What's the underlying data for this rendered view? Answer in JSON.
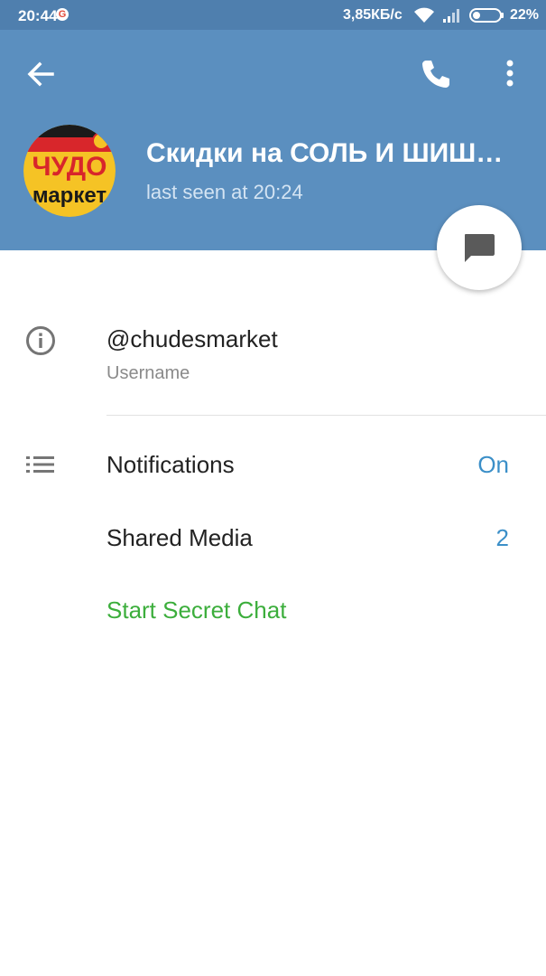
{
  "status_bar": {
    "time": "20:44",
    "speed": "3,85КБ/с",
    "battery": "22%",
    "google_icon": "google-icon",
    "wifi_icon": "wifi-icon",
    "signal_icon": "signal-icon",
    "battery_icon": "battery-icon"
  },
  "header": {
    "title": "Скидки на СОЛЬ И ШИШ…",
    "subtitle": "last seen at 20:24",
    "back_icon": "arrow-left-icon",
    "call_icon": "phone-icon",
    "menu_icon": "more-vert-icon",
    "avatar_text_top": "ЧУДО",
    "avatar_text_bottom": "маркет"
  },
  "fab_icon": "message-icon",
  "info": {
    "username": "@chudesmarket",
    "username_label": "Username",
    "icon": "info-icon"
  },
  "rows": {
    "notifications_label": "Notifications",
    "notifications_value": "On",
    "shared_media_label": "Shared Media",
    "shared_media_value": "2",
    "secret_chat_label": "Start Secret Chat",
    "list_icon": "list-icon"
  },
  "colors": {
    "header": "#5b8fbf",
    "status_bar": "#4f7fae",
    "accent_blue": "#3b8fc8",
    "accent_green": "#3cae3c"
  }
}
